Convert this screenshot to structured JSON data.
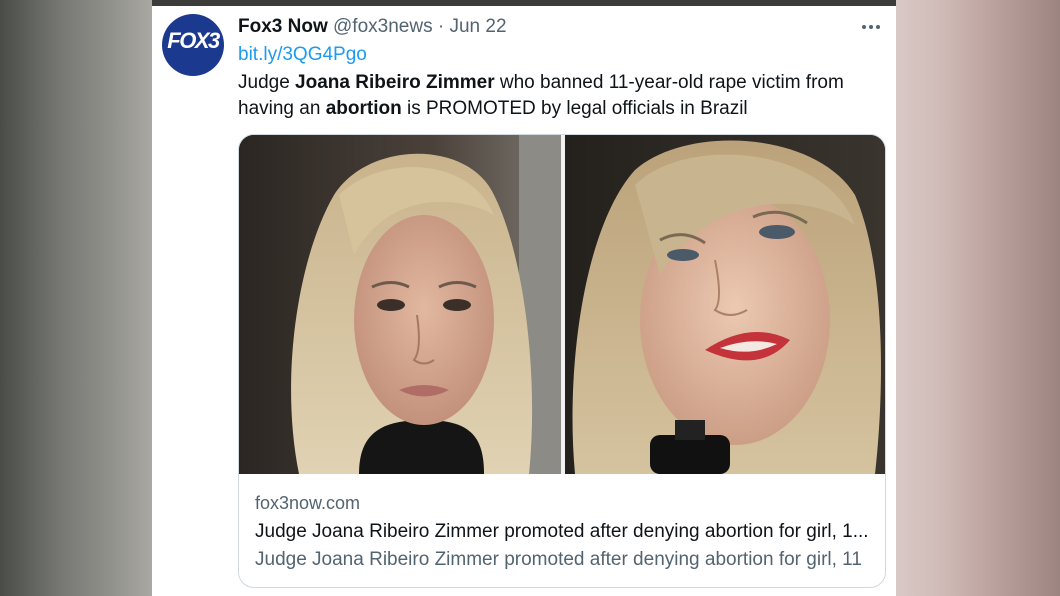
{
  "account": {
    "display_name": "Fox3 Now",
    "handle": "@fox3news",
    "separator": "·",
    "date": "Jun 22",
    "avatar_text": "FOX3"
  },
  "tweet": {
    "link": "bit.ly/3QG4Pgo",
    "text_parts": {
      "p1": "Judge ",
      "b1": "Joana Ribeiro Zimmer",
      "p2": " who banned 11-year-old rape victim from having an ",
      "b2": "abortion",
      "p3": " is PROMOTED by legal officials in Brazil"
    }
  },
  "card": {
    "domain": "fox3now.com",
    "title": "Judge Joana Ribeiro Zimmer promoted after denying abortion for girl, 1...",
    "description": "Judge Joana Ribeiro Zimmer promoted after denying abortion for girl, 11"
  },
  "icons": {
    "more": "more-options-icon"
  },
  "colors": {
    "link": "#1d9bf0",
    "secondary_text": "#536471",
    "primary_text": "#0f1419",
    "avatar_bg": "#1b3a8f"
  }
}
